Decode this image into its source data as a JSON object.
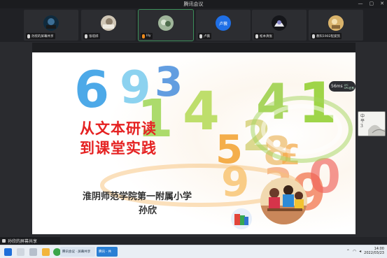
{
  "window": {
    "title": "腾讯会议",
    "controls": [
      "—",
      "▢",
      "✕"
    ]
  },
  "participants": [
    {
      "name": "孙欣的屏幕共享",
      "avatar_color": "#20405a",
      "active": false
    },
    {
      "name": "张培烨",
      "avatar_color": "#b9b0a0",
      "active": false
    },
    {
      "name": "Illy",
      "avatar_color": "#6c8c6a",
      "active": true
    },
    {
      "name": "卢薇",
      "avatar_text": "卢薇",
      "avatar_color": "#1f6fe6",
      "active": false
    },
    {
      "name": "松本清张",
      "avatar_color": "#2b2c30",
      "active": false
    },
    {
      "name": "教科1902程爱凯",
      "avatar_color": "#c7a064",
      "active": false
    }
  ],
  "network": {
    "latency": "56ms",
    "line1": "4℃",
    "line2": "CPU正常"
  },
  "side_thumb": {
    "text": "中\n平\n3"
  },
  "slide": {
    "title_line1": "从文本研读",
    "title_line2": "到课堂实践",
    "school": "淮阴师范学院第一附属小学",
    "presenter": "孙欣"
  },
  "share_bar": {
    "label": "孙欣的屏幕共享"
  },
  "taskbar": {
    "task1": "腾讯会议 · 屏幕共享",
    "task2": "腾讯 - 共",
    "time": "14:00",
    "date": "2022/03/23"
  },
  "colors": {
    "title_red": "#e52222",
    "accent_green": "#3c8f5a"
  }
}
